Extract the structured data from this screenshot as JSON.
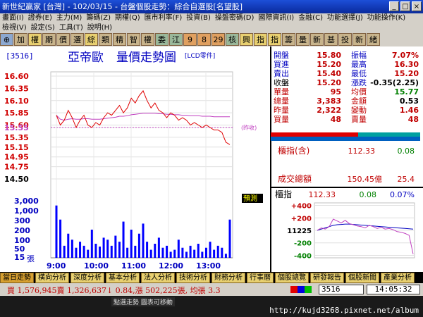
{
  "window": {
    "title": "新世紀贏家 [台灣] - 102/03/15 - 台盤個股走勢：綜合自選股[名望股]",
    "buttons": [
      "_",
      "□",
      "×"
    ]
  },
  "menu_row1": [
    "畫面(I)",
    "證券(E)",
    "主力(M)",
    "籌碼(Z)",
    "期權(Q)",
    "匯市利率(F)",
    "投資(B)",
    "操盤密碼(D)",
    "國際資訊(I)",
    "金融(C)",
    "功能選擇(J)",
    "功能操作(K)"
  ],
  "menu_row2": [
    "檢視(V)",
    "設定(S)",
    "工具(T)",
    "說明(H)"
  ],
  "toolbar": [
    "⊕",
    "加",
    "權",
    "期",
    "價",
    "選",
    "綜",
    "類",
    "精",
    "智",
    "權",
    "委",
    "江",
    "9",
    "8",
    "29",
    "核",
    "興",
    "指",
    "指",
    "籌",
    "量",
    "新",
    "基",
    "投",
    "新",
    "緒"
  ],
  "stock": {
    "code": "[3516]",
    "name": "亞帝歐",
    "chart_title": "量價走勢圖",
    "tag": "[LCD零件]",
    "ref_label": "(昨收)",
    "warn": "預測"
  },
  "quote": {
    "rows": [
      [
        {
          "l": "開盤",
          "v": "15.80"
        },
        {
          "l": "振幅",
          "v": "7.07%"
        }
      ],
      [
        {
          "l": "買進",
          "v": "15.20"
        },
        {
          "l": "最高",
          "v": "16.30"
        }
      ],
      [
        {
          "l": "賣出",
          "v": "15.40"
        },
        {
          "l": "最低",
          "v": "15.20"
        }
      ],
      [
        {
          "l": "收盤",
          "v": "15.20"
        },
        {
          "l": "漲跌",
          "v": "-0.35(2.25)"
        }
      ],
      [
        {
          "l": "單量",
          "v": "95"
        },
        {
          "l": "均價",
          "v": "15.77"
        }
      ],
      [
        {
          "l": "總量",
          "v": "3,383"
        },
        {
          "l": "金額",
          "v": "0.53"
        }
      ],
      [
        {
          "l": "昨量",
          "v": "2,322"
        },
        {
          "l": "變動",
          "v": "1.46"
        }
      ],
      [
        {
          "l": "買量",
          "v": "48"
        },
        {
          "l": "賣量",
          "v": "48"
        }
      ]
    ]
  },
  "index_box": {
    "label": "櫃指(含)",
    "value": "112.33",
    "change": "0.08",
    "vol_label": "成交總額",
    "vol_value": "150.45億",
    "vol_change": "25.4"
  },
  "mini": {
    "label": "櫃指",
    "value": "112.33",
    "change": "0.08",
    "pct": "0.07%",
    "yticks": [
      "+400",
      "+200",
      "11225",
      "-200",
      "-400"
    ]
  },
  "tickers": [
    "當日走勢",
    "橫向分析",
    "深度分析",
    "基本分析",
    "法人分析",
    "技術分析",
    "財務分析",
    "行事曆",
    "個股總覽",
    "研發報告",
    "個股新聞",
    "產業分析"
  ],
  "status": {
    "text": "買 1,576,945賣 1,326,637↓ 0.84,漲 502,225張, 均張 3.3",
    "code": "3516",
    "clock": "14:05:32"
  },
  "footer": {
    "pill": "點選走勢 圖表可移動",
    "url": "http://kujd3268.pixnet.net/album"
  },
  "colors": {
    "price_line": "#e00000",
    "avg_line": "#c040c0",
    "volume": "#0000ff",
    "label_red": "#d00000",
    "label_blue": "#0000c0"
  },
  "chart_data": {
    "type": "line",
    "title": "量價走勢圖",
    "price_ticks": [
      "16.60",
      "16.35",
      "16.10",
      "15.85",
      "15.60",
      "15.55",
      "15.35",
      "15.15",
      "14.95",
      "14.75",
      "14.50"
    ],
    "ref_price": 15.55,
    "volume_ticks": [
      "3,000",
      "1,000",
      "300",
      "200",
      "100",
      "50",
      "15"
    ],
    "volume_unit": "張",
    "x_ticks": [
      "9:00",
      "10:00",
      "11:00",
      "12:00",
      "13:00"
    ],
    "price": [
      15.8,
      15.6,
      15.7,
      15.9,
      15.75,
      15.55,
      15.7,
      15.8,
      15.6,
      15.55,
      15.65,
      15.6,
      15.75,
      15.85,
      15.8,
      15.9,
      16.0,
      15.85,
      15.95,
      16.15,
      16.05,
      16.2,
      16.3,
      16.1,
      15.95,
      16.05,
      15.9,
      15.85,
      15.75,
      15.85,
      15.8,
      15.7,
      15.75,
      15.7,
      15.6,
      15.65,
      15.6,
      15.55,
      15.6,
      15.55,
      15.5,
      15.5,
      15.45,
      15.25,
      15.2
    ],
    "avg": [
      15.8,
      15.72,
      15.7,
      15.72,
      15.73,
      15.72,
      15.72,
      15.73,
      15.73,
      15.72,
      15.72,
      15.72,
      15.73,
      15.74,
      15.75,
      15.76,
      15.78,
      15.78,
      15.79,
      15.81,
      15.82,
      15.83,
      15.84,
      15.84,
      15.84,
      15.84,
      15.83,
      15.83,
      15.82,
      15.82,
      15.81,
      15.81,
      15.8,
      15.8,
      15.79,
      15.79,
      15.79,
      15.78,
      15.78,
      15.78,
      15.77,
      15.77,
      15.77,
      15.77,
      15.77
    ],
    "volume": [
      130,
      95,
      30,
      60,
      45,
      25,
      40,
      30,
      20,
      70,
      35,
      28,
      50,
      45,
      30,
      55,
      40,
      90,
      25,
      70,
      30,
      60,
      85,
      40,
      20,
      35,
      50,
      25,
      30,
      15,
      20,
      45,
      25,
      15,
      30,
      20,
      35,
      15,
      25,
      40,
      20,
      30,
      25,
      10,
      95
    ],
    "mini_line": [
      0,
      40,
      20,
      60,
      180,
      150,
      120,
      160,
      110,
      90,
      70,
      60,
      40,
      80,
      60,
      30,
      50,
      20,
      30,
      10,
      -20,
      -30,
      -50,
      -80,
      -380
    ],
    "mini_avg": [
      0,
      20,
      40,
      60,
      80,
      90,
      95,
      100,
      100,
      95,
      90,
      85,
      80,
      75,
      70,
      65,
      60,
      55,
      50,
      45,
      40,
      35,
      30,
      25,
      20
    ]
  }
}
